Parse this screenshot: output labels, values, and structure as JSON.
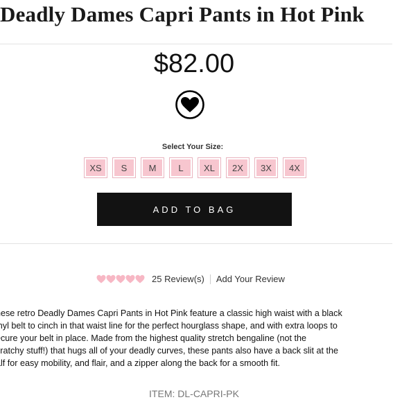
{
  "product": {
    "title": "Deadly Dames Capri Pants in Hot Pink",
    "price": "$82.00",
    "wishlist_icon": "heart-icon",
    "size_label": "Select Your Size:",
    "sizes": [
      "XS",
      "S",
      "M",
      "L",
      "XL",
      "2X",
      "3X",
      "4X"
    ],
    "add_to_bag_label": "ADD TO BAG"
  },
  "reviews": {
    "rating_icon": "heart-rating-icon",
    "rating": 5,
    "rating_max": 5,
    "rating_color": "#f7b7c4",
    "count_label": "25 Review(s)",
    "add_label": "Add Your Review"
  },
  "description": {
    "lines": [
      "hese retro Deadly Dames Capri Pants in Hot Pink feature a classic high waist with a black",
      "inyl belt to cinch in that waist line for the perfect hourglass shape, and with extra loops to",
      "ecure your belt in place. Made from the highest quality stretch bengaline (not the",
      "cratchy stuff!) that hugs all of your deadly curves, these pants also have a back slit at the",
      "alf for easy mobility, and flair, and a zipper along the back for a smooth fit."
    ]
  },
  "item": {
    "code_label": "ITEM: DL-CAPRI-PK"
  },
  "colors": {
    "size_button_bg": "#f7c6cf",
    "add_button_bg": "#121212",
    "item_code_text": "#777777"
  }
}
